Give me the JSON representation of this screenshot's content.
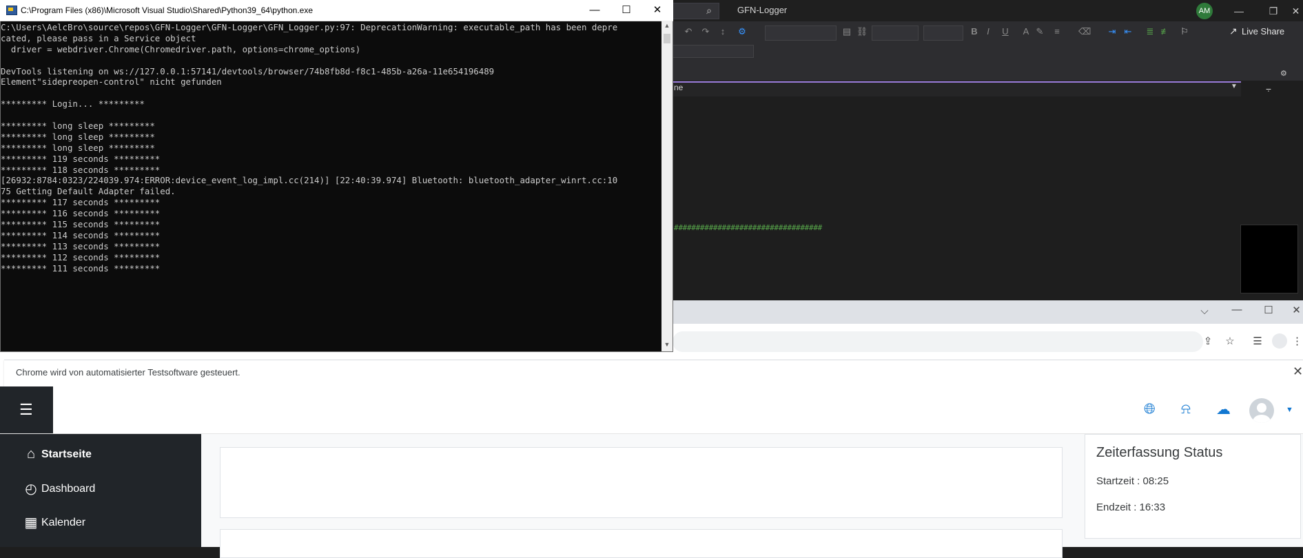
{
  "vs": {
    "solution_name": "GFN-Logger",
    "user_initials": "AM",
    "live_share_label": "Live Share",
    "nav_text": "ne",
    "hash_line": "##################################"
  },
  "chrome": {
    "infobar_text": "Chrome wird von automatisierter Testsoftware gesteuert."
  },
  "moodle": {
    "nav": [
      {
        "label": "Startseite",
        "icon": "home-icon"
      },
      {
        "label": "Dashboard",
        "icon": "dashboard-icon"
      },
      {
        "label": "Kalender",
        "icon": "calendar-icon"
      }
    ],
    "zeiterfassung": {
      "title": "Zeiterfassung Status",
      "start": "Startzeit : 08:25",
      "end": "Endzeit : 16:33"
    }
  },
  "console": {
    "title": "C:\\Program Files (x86)\\Microsoft Visual Studio\\Shared\\Python39_64\\python.exe",
    "lines": [
      "C:\\Users\\AelcBro\\source\\repos\\GFN-Logger\\GFN-Logger\\GFN_Logger.py:97: DeprecationWarning: executable_path has been depre",
      "cated, please pass in a Service object",
      "  driver = webdriver.Chrome(Chromedriver.path, options=chrome_options)",
      "",
      "DevTools listening on ws://127.0.0.1:57141/devtools/browser/74b8fb8d-f8c1-485b-a26a-11e654196489",
      "Element\"sidepreopen-control\" nicht gefunden",
      "",
      "********* Login... *********",
      "",
      "********* long sleep *********",
      "********* long sleep *********",
      "********* long sleep *********",
      "********* 119 seconds *********",
      "********* 118 seconds *********",
      "[26932:8784:0323/224039.974:ERROR:device_event_log_impl.cc(214)] [22:40:39.974] Bluetooth: bluetooth_adapter_winrt.cc:10",
      "75 Getting Default Adapter failed.",
      "********* 117 seconds *********",
      "********* 116 seconds *********",
      "********* 115 seconds *********",
      "********* 114 seconds *********",
      "********* 113 seconds *********",
      "********* 112 seconds *********",
      "********* 111 seconds *********"
    ]
  }
}
